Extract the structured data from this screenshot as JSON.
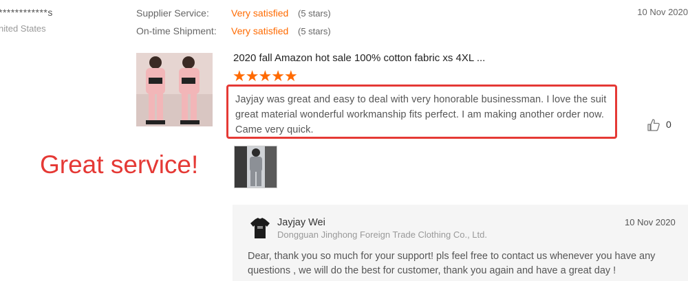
{
  "reviewer": {
    "name": "************s",
    "country": "nited States"
  },
  "ratings": [
    {
      "label": "Supplier Service:",
      "value": "Very satisfied",
      "stars": "(5 stars)"
    },
    {
      "label": "On-time Shipment:",
      "value": "Very satisfied",
      "stars": "(5 stars)"
    }
  ],
  "review": {
    "date": "10 Nov 2020",
    "product_title": "2020 fall Amazon hot sale 100% cotton fabric xs 4XL ...",
    "star_count": 5,
    "text": "Jayjay was great and easy to deal with very honorable businessman. I love the suit great material wonderful workmanship fits perfect. I  am making another order now. Came very quick.",
    "like_count": "0"
  },
  "annotation": "Great service!",
  "reply": {
    "name": "Jayjay Wei",
    "company": "Dongguan Jinghong Foreign Trade Clothing Co., Ltd.",
    "date": "10 Nov 2020",
    "text": "Dear, thank you so much for your support!  pls feel free to contact us whenever you have any questions , we will  do the best for customer, thank you again and have a great day !"
  },
  "colors": {
    "accent": "#ff6a00",
    "annotation": "#e53935",
    "reply_bg": "#f5f5f5"
  },
  "icons": {
    "like": "thumbs-up-icon",
    "star": "star-icon"
  }
}
